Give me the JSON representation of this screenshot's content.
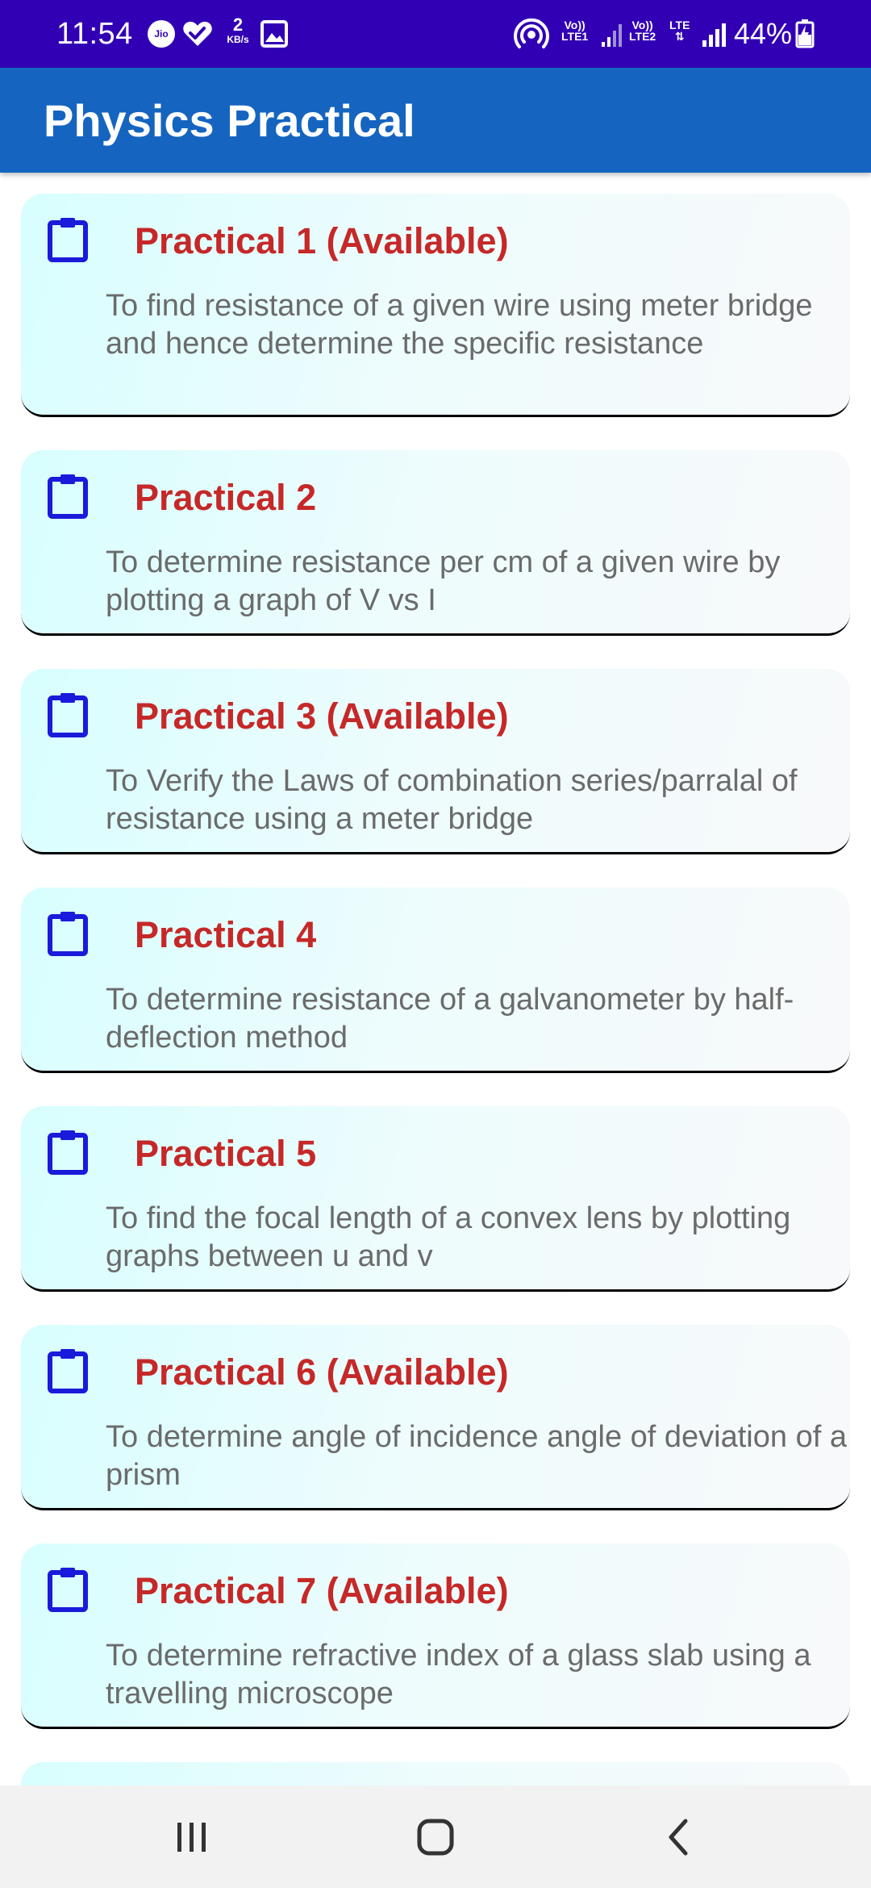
{
  "status_bar": {
    "time": "11:54",
    "jio_label": "Jio",
    "speed_value": "2",
    "speed_unit": "KB/s",
    "sim1_label_top": "Vo))",
    "sim1_label_bottom": "LTE1",
    "sim2_label_top": "Vo))",
    "sim2_label_bottom": "LTE2",
    "lte_label": "LTE",
    "battery": "44%",
    "background_color": "#3200b4"
  },
  "app_bar": {
    "title": "Physics Practical",
    "background_color": "#1565c0"
  },
  "practicals": [
    {
      "title": "Practical 1 (Available)",
      "description": "To find resistance of a given wire using meter bridge and hence determine the specific resistance"
    },
    {
      "title": "Practical 2",
      "description": "To determine resistance per cm of a given wire by plotting a graph of V vs I"
    },
    {
      "title": "Practical 3 (Available)",
      "description": "To Verify the Laws of combination series/parralal of resistance using a meter bridge"
    },
    {
      "title": "Practical 4",
      "description": "To determine resistance of a galvanometer by half-deflection method"
    },
    {
      "title": "Practical 5",
      "description": "To find the focal length of a convex lens by plotting graphs between u and v"
    },
    {
      "title": "Practical 6 (Available)",
      "description": "To determine angle of incidence angle of deviation of a prism"
    },
    {
      "title": "Practical 7 (Available)",
      "description": "To determine refractive index of a glass slab using a travelling microscope"
    },
    {
      "title": "",
      "description": ""
    }
  ],
  "card_icon": "clipboard-icon",
  "colors": {
    "title_red": "#c62828",
    "icon_blue": "#1a1adb",
    "card_gradient_start": "#d8fefe"
  },
  "nav_bar": {
    "items": [
      "recent-apps-icon",
      "home-icon",
      "back-icon"
    ]
  }
}
